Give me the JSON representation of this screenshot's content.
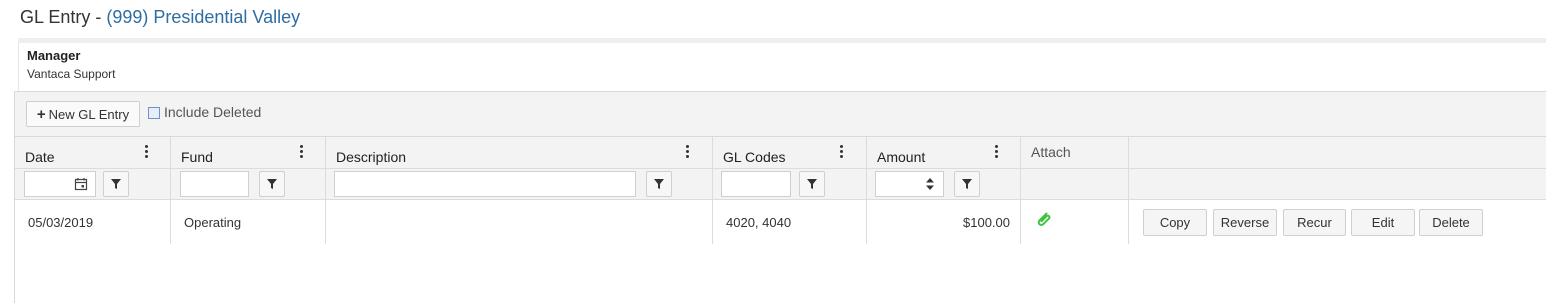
{
  "page": {
    "title_prefix": "GL Entry - ",
    "property": "(999) Presidential Valley"
  },
  "manager": {
    "label": "Manager",
    "value": "Vantaca Support"
  },
  "toolbar": {
    "new_label": "New GL Entry",
    "include_deleted_label": "Include Deleted",
    "include_deleted_checked": false
  },
  "columns": {
    "date": "Date",
    "fund": "Fund",
    "description": "Description",
    "gl_codes": "GL Codes",
    "amount": "Amount",
    "attach": "Attach"
  },
  "rows": [
    {
      "date": "05/03/2019",
      "fund": "Operating",
      "description": "",
      "gl_codes": "4020, 4040",
      "amount": "$100.00",
      "attach_icon": "paperclip-icon",
      "actions": {
        "copy": "Copy",
        "reverse": "Reverse",
        "recur": "Recur",
        "edit": "Edit",
        "delete": "Delete"
      }
    }
  ],
  "colors": {
    "property_link": "#2e6da4",
    "attach_icon": "#3cc43c"
  }
}
